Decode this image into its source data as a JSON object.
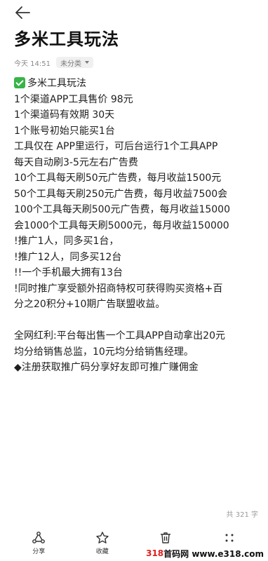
{
  "header": {
    "back_icon": "arrow-left-icon"
  },
  "note": {
    "title": "多米工具玩法",
    "time": "今天 14:51",
    "category": "未分类",
    "lines": [
      "多米工具玩法",
      "1个渠道APP工具售价 98元",
      "1个渠道码有效期 30天",
      "1个账号初始只能买1台",
      "工具仅在 APP里运行，可后台运行1个工具APP",
      "每天自动刷3-5元左右广告费",
      "10个工具每天刷50元广告费，每月收益1500元",
      "50个工具每天刷250元广告费，每月收益7500会",
      "100个工具每天刷500元广告费，每月收益15000",
      "会1000个工具每天刷5000元，每月收益150000",
      "!推广1人，同多买1台，",
      "!推广12人，同多买12台",
      "!!一个手机最大拥有13台",
      "!同时推广享受额外招商特权可获得购买资格+百",
      "分之20积分+10期广告联盟收益。",
      "",
      "全网红利:平台每出售一个工具APP自动拿出20元",
      "均分给销售总监，10元均分给销售经理。",
      "◆注册获取推广码分享好友即可推广赚佣金"
    ],
    "char_count": "共 321 字"
  },
  "toolbar": {
    "share_label": "分享",
    "favorite_label": "收藏",
    "delete_label": "删除",
    "more_label": "更多"
  },
  "watermark": {
    "prefix": "318",
    "site": "首码网 www.e318.com"
  },
  "colors": {
    "check": "#38b449",
    "watermark_accent": "#e02020"
  }
}
